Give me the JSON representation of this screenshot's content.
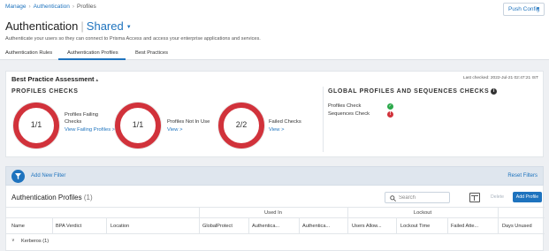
{
  "breadcrumb": [
    "Manage",
    "Authentication",
    "Profiles"
  ],
  "header": {
    "push_config": "Push Config",
    "title": "Authentication",
    "scope": "Shared",
    "subtitle": "Authenticate your users so they can connect to Prisma Access and access your enterprise applications and services."
  },
  "tabs": [
    "Authentication Rules",
    "Authentication Profiles",
    "Best Practices"
  ],
  "active_tab": "Authentication Profiles",
  "assessment": {
    "title": "Best Practice Assessment",
    "last_checked": "Last checked: 2022-Jul-21 02:47:21 IST",
    "profiles_checks_title": "PROFILES CHECKS",
    "checks": [
      {
        "value": "1/1",
        "label_line1": "Profiles Failing",
        "label_line2": "Checks",
        "link": "View Failing Profiles >"
      },
      {
        "value": "1/1",
        "label_line1": "Profiles Not In Use",
        "label_line2": "",
        "link": "View >"
      },
      {
        "value": "2/2",
        "label_line1": "Failed Checks",
        "label_line2": "",
        "link": "View >"
      }
    ],
    "global_title": "GLOBAL PROFILES AND SEQUENCES CHECKS",
    "global_items": [
      {
        "label": "Profiles Check",
        "status": "pass"
      },
      {
        "label": "Sequences Check",
        "status": "fail"
      }
    ]
  },
  "filter": {
    "add_label": "Add New Filter",
    "reset_label": "Reset Filters"
  },
  "table": {
    "title": "Authentication Profiles",
    "count": "(1)",
    "search_placeholder": "Search",
    "delete_label": "Delete",
    "add_label": "Add Profile",
    "group_headers": {
      "used_in": "Used In",
      "lockout": "Lockout"
    },
    "columns": [
      "Name",
      "BPA Verdict",
      "Location",
      "GlobalProtect",
      "Authentica...",
      "Authentica...",
      "Users Allow...",
      "Lockout Time",
      "Failed Atte...",
      "Days Unused"
    ],
    "groups": [
      {
        "name": "Kerberos (1)"
      }
    ]
  },
  "colors": {
    "accent": "#1e73be",
    "fail": "#d1323b",
    "pass": "#2aa84a"
  },
  "icons": [
    "chevron-down-icon",
    "filter-icon",
    "search-icon",
    "columns-icon",
    "info-icon",
    "check-circle-icon",
    "error-circle-icon"
  ]
}
